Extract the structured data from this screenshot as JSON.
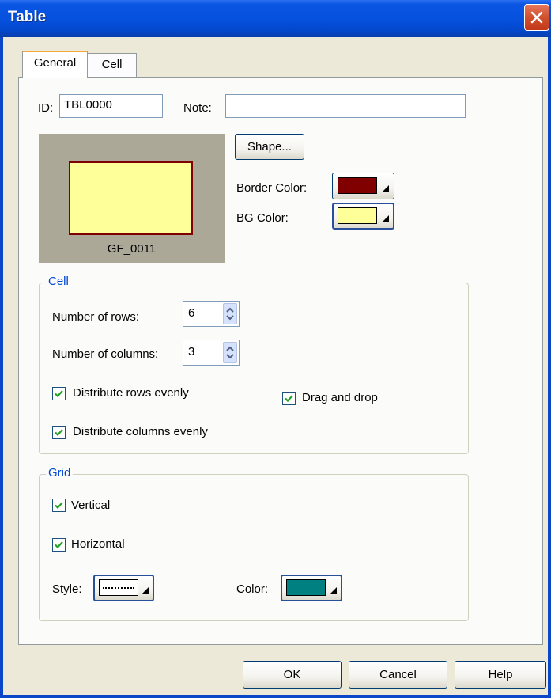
{
  "window": {
    "title": "Table"
  },
  "tabs": [
    {
      "label": "General"
    },
    {
      "label": "Cell"
    }
  ],
  "general": {
    "id_label": "ID:",
    "id_value": "TBL0000",
    "note_label": "Note:",
    "note_value": "",
    "preview_caption": "GF_0011",
    "shape_button": "Shape...",
    "border_color_label": "Border Color:",
    "border_color": "#800000",
    "bg_color_label": "BG Color:",
    "bg_color": "#ffff99"
  },
  "cell_group": {
    "title": "Cell",
    "rows_label": "Number of rows:",
    "rows_value": "6",
    "columns_label": "Number of columns:",
    "columns_value": "3",
    "distribute_rows_label": "Distribute rows evenly",
    "distribute_rows_checked": true,
    "distribute_columns_label": "Distribute columns evenly",
    "distribute_columns_checked": true,
    "drag_drop_label": "Drag and drop",
    "drag_drop_checked": true
  },
  "grid_group": {
    "title": "Grid",
    "vertical_label": "Vertical",
    "vertical_checked": true,
    "horizontal_label": "Horizontal",
    "horizontal_checked": true,
    "style_label": "Style:",
    "color_label": "Color:",
    "grid_color": "#008080"
  },
  "buttons": {
    "ok": "OK",
    "cancel": "Cancel",
    "help": "Help"
  }
}
